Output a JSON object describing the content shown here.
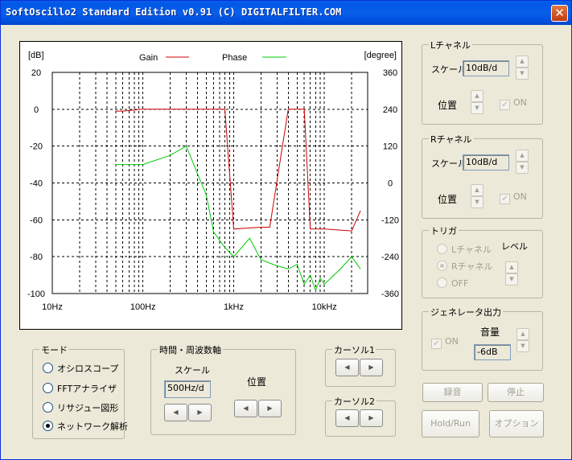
{
  "window": {
    "title": "SoftOscillo2 Standard Edition v0.91 (C) DIGITALFILTER.COM",
    "close_glyph": "✕"
  },
  "chart_data": {
    "type": "line",
    "xscale": "log",
    "xlim": [
      10,
      30000
    ],
    "x_ticks": [
      "10Hz",
      "100Hz",
      "1kHz",
      "10kHz"
    ],
    "y_left": {
      "label": "[dB]",
      "lim": [
        -100,
        20
      ],
      "ticks": [
        "20",
        "0",
        "-20",
        "-40",
        "-60",
        "-80",
        "-100"
      ]
    },
    "y_right": {
      "label": "[degree]",
      "lim": [
        -360,
        360
      ],
      "ticks": [
        "360",
        "240",
        "120",
        "0",
        "-120",
        "-240",
        "-360"
      ]
    },
    "grid": true,
    "legend_position": "top",
    "series": [
      {
        "name": "Gain",
        "color": "#cc0000",
        "axis": "left",
        "x": [
          50,
          60,
          100,
          200,
          400,
          700,
          800,
          1000,
          2000,
          2500,
          4000,
          5000,
          6000,
          7000,
          8000,
          10000,
          20000,
          25000
        ],
        "y": [
          -1,
          -1,
          0,
          0,
          0,
          0,
          0,
          -65,
          -64,
          -64,
          0,
          0,
          0,
          -65,
          -65,
          -65,
          -66,
          -55
        ]
      },
      {
        "name": "Phase",
        "color": "#00cc00",
        "axis": "right",
        "x": [
          50,
          100,
          200,
          300,
          500,
          600,
          800,
          1000,
          1500,
          2000,
          3000,
          4000,
          5000,
          6000,
          7000,
          8000,
          9000,
          10000,
          15000,
          20000,
          25000
        ],
        "y": [
          60,
          60,
          90,
          120,
          -40,
          -160,
          -210,
          -240,
          -180,
          -250,
          -270,
          -280,
          -265,
          -330,
          -300,
          -350,
          -310,
          -330,
          -280,
          -240,
          -280
        ]
      }
    ]
  },
  "lchannel": {
    "legend": "Lチャネル",
    "scale_label": "スケール",
    "scale_value": "10dB/d",
    "position_label": "位置",
    "on_label": "ON"
  },
  "rchannel": {
    "legend": "Rチャネル",
    "scale_label": "スケール",
    "scale_value": "10dB/d",
    "position_label": "位置",
    "on_label": "ON"
  },
  "trigger": {
    "legend": "トリガ",
    "options": [
      "Lチャネル",
      "Rチャネル",
      "OFF"
    ],
    "selected": "Rチャネル",
    "level_label": "レベル"
  },
  "generator": {
    "legend": "ジェネレータ出力",
    "on_label": "ON",
    "volume_label": "音量",
    "volume_value": "-6dB"
  },
  "mode": {
    "legend": "モード",
    "options": [
      "オシロスコープ",
      "FFTアナライザ",
      "リサジュー図形",
      "ネットワーク解析"
    ],
    "selected": "ネットワーク解析"
  },
  "timefreq": {
    "legend": "時間・周波数軸",
    "scale_label": "スケール",
    "scale_value": "500Hz/d",
    "position_label": "位置"
  },
  "cursor1": {
    "legend": "カーソル1"
  },
  "cursor2": {
    "legend": "カーソル2"
  },
  "buttons": {
    "record": "録音",
    "stop": "停止",
    "holdrun": "Hold/Run",
    "options": "オプション"
  }
}
